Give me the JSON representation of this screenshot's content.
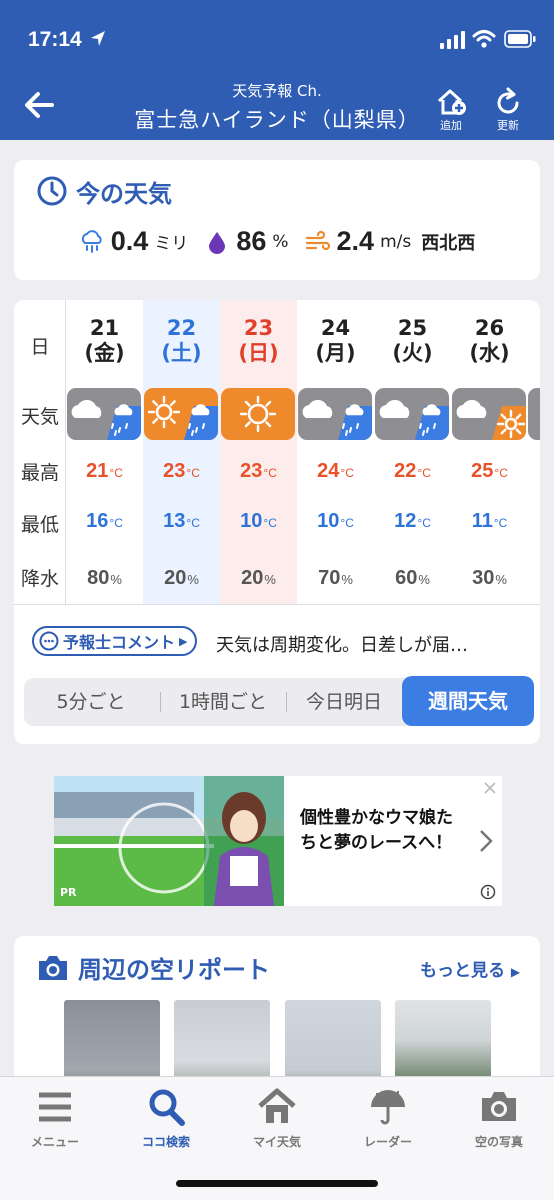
{
  "status_bar": {
    "time": "17:14"
  },
  "nav": {
    "subtitle": "天気予報 Ch.",
    "title": "富士急ハイランド（山梨県）",
    "add_label": "追加",
    "refresh_label": "更新"
  },
  "current": {
    "title": "今の天気",
    "precip": "0.4",
    "precip_unit": "ミリ",
    "humidity": "86",
    "humidity_unit": "%",
    "wind": "2.4",
    "wind_unit": "m/s",
    "wind_dir": "西北西"
  },
  "weekly": {
    "labels": {
      "day": "日",
      "weather": "天気",
      "high": "最高",
      "low": "最低",
      "precip": "降水"
    },
    "temp_unit": "°C",
    "pct_unit": "%",
    "days": [
      {
        "date": "21",
        "dow": "(金)",
        "weather": "cloudy-then-rain",
        "high": "21",
        "low": "16",
        "precip": "80"
      },
      {
        "date": "22",
        "dow": "(土)",
        "weather": "sunny-then-rain",
        "high": "23",
        "low": "13",
        "precip": "20"
      },
      {
        "date": "23",
        "dow": "(日)",
        "weather": "sunny",
        "high": "23",
        "low": "10",
        "precip": "20"
      },
      {
        "date": "24",
        "dow": "(月)",
        "weather": "cloudy-then-rain",
        "high": "24",
        "low": "10",
        "precip": "70"
      },
      {
        "date": "25",
        "dow": "(火)",
        "weather": "cloudy-then-rain",
        "high": "22",
        "low": "12",
        "precip": "60"
      },
      {
        "date": "26",
        "dow": "(水)",
        "weather": "cloudy-then-sunny",
        "high": "25",
        "low": "11",
        "precip": "30"
      }
    ],
    "colors": {
      "cloud_bg": "#8e8e93",
      "sun_bg": "#ef8a2c",
      "rain_bg": "#3c7de4"
    }
  },
  "comment": {
    "button_label": "予報士コメント",
    "text": "天気は周期変化。日差しが届…"
  },
  "segments": {
    "items": [
      "5分ごと",
      "1時間ごと",
      "今日明日"
    ],
    "active": "週間天気"
  },
  "ad": {
    "text_line1": "個性豊かなウマ娘た",
    "text_line2": "ちと夢のレースへ！",
    "pr": "PR"
  },
  "sky_report": {
    "title": "周辺の空リポート",
    "more_label": "もっと見る"
  },
  "tabbar": {
    "items": [
      {
        "label": "メニュー",
        "icon": "menu-icon"
      },
      {
        "label": "ココ検索",
        "icon": "search-icon"
      },
      {
        "label": "マイ天気",
        "icon": "home-icon"
      },
      {
        "label": "レーダー",
        "icon": "umbrella-icon"
      },
      {
        "label": "空の写真",
        "icon": "camera-icon"
      }
    ],
    "active_index": 1
  }
}
